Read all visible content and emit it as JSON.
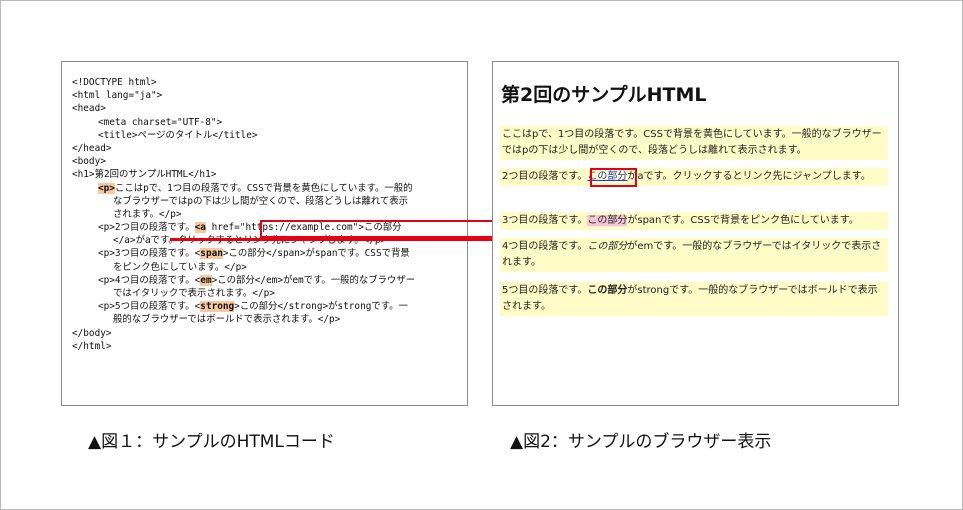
{
  "figure1": {
    "caption": "▲図１：サンプルのHTMLコード",
    "code": {
      "l1": "<!DOCTYPE html>",
      "l2": "<html lang=\"ja\">",
      "l3": "<head>",
      "l4": "<meta charset=\"UTF-8\">",
      "l5": "<title>ページのタイトル</title>",
      "l6": "</head>",
      "l7": "<body>",
      "l8": "<h1>第2回のサンプルHTML</h1>",
      "l9_tag": "<p>",
      "l9_text": "ここはpで、1つ目の段落です。CSSで背景を黄色にしています。一般的",
      "l10": "なブラウザーではpの下は少し間が空くので、段落どうしは離れて表示",
      "l11": "されます。</p>",
      "l12_a": "<p>2つ目の段落です。",
      "l12_tag": "<a",
      "l12_b": " href=\"https://example.com\">この部分",
      "l13": "</a>がaです。クリックするとリンク先にジャンプします。</p>",
      "l14_a": "<p>3つ目の段落です。<",
      "l14_tag": "span",
      "l14_b": ">この部分</span>がspanです。CSSで背景",
      "l15": "をピンク色にしています。</p>",
      "l16_a": "<p>4つ目の段落です。<",
      "l16_tag": "em",
      "l16_b": ">この部分</em>がemです。一般的なブラウザー",
      "l17": "ではイタリックで表示されます。</p>",
      "l18_a": "<p>5つ目の段落です。<",
      "l18_tag": "strong",
      "l18_b": ">この部分</strong>がstrongです。一",
      "l19": "般的なブラウザーではボールドで表示されます。</p>",
      "l20": "</body>",
      "l21": "</html>"
    }
  },
  "figure2": {
    "caption": "▲図2：サンプルのブラウザー表示",
    "heading": "第2回のサンプルHTML",
    "p1": "ここはpで、1つ目の段落です。CSSで背景を黄色にしています。一般的なブラウザーではpの下は少し間が空くので、段落どうしは離れて表示されます。",
    "p2_before": "2つ目の段落です。",
    "p2_link": "この部分",
    "p2_after": "がaです。クリックするとリンク先にジャンプします。",
    "p3_before": "3つ目の段落です。",
    "p3_span": "この部分",
    "p3_after": "がspanです。CSSで背景をピンク色にしています。",
    "p4_before": "4つ目の段落です。",
    "p4_em": "この部分",
    "p4_after": "がemです。一般的なブラウザーではイタリックで表示されます。",
    "p5_before": "5つ目の段落です。",
    "p5_strong": "この部分",
    "p5_after": "がstrongです。一般的なブラウザーではボールドで表示されます。"
  },
  "colors": {
    "highlight_red": "#e60012",
    "paragraph_bg": "#fffcc8",
    "span_pink": "#f5c6d8",
    "tag_orange": "#f8c9a0",
    "link_blue": "#1a39d6"
  }
}
